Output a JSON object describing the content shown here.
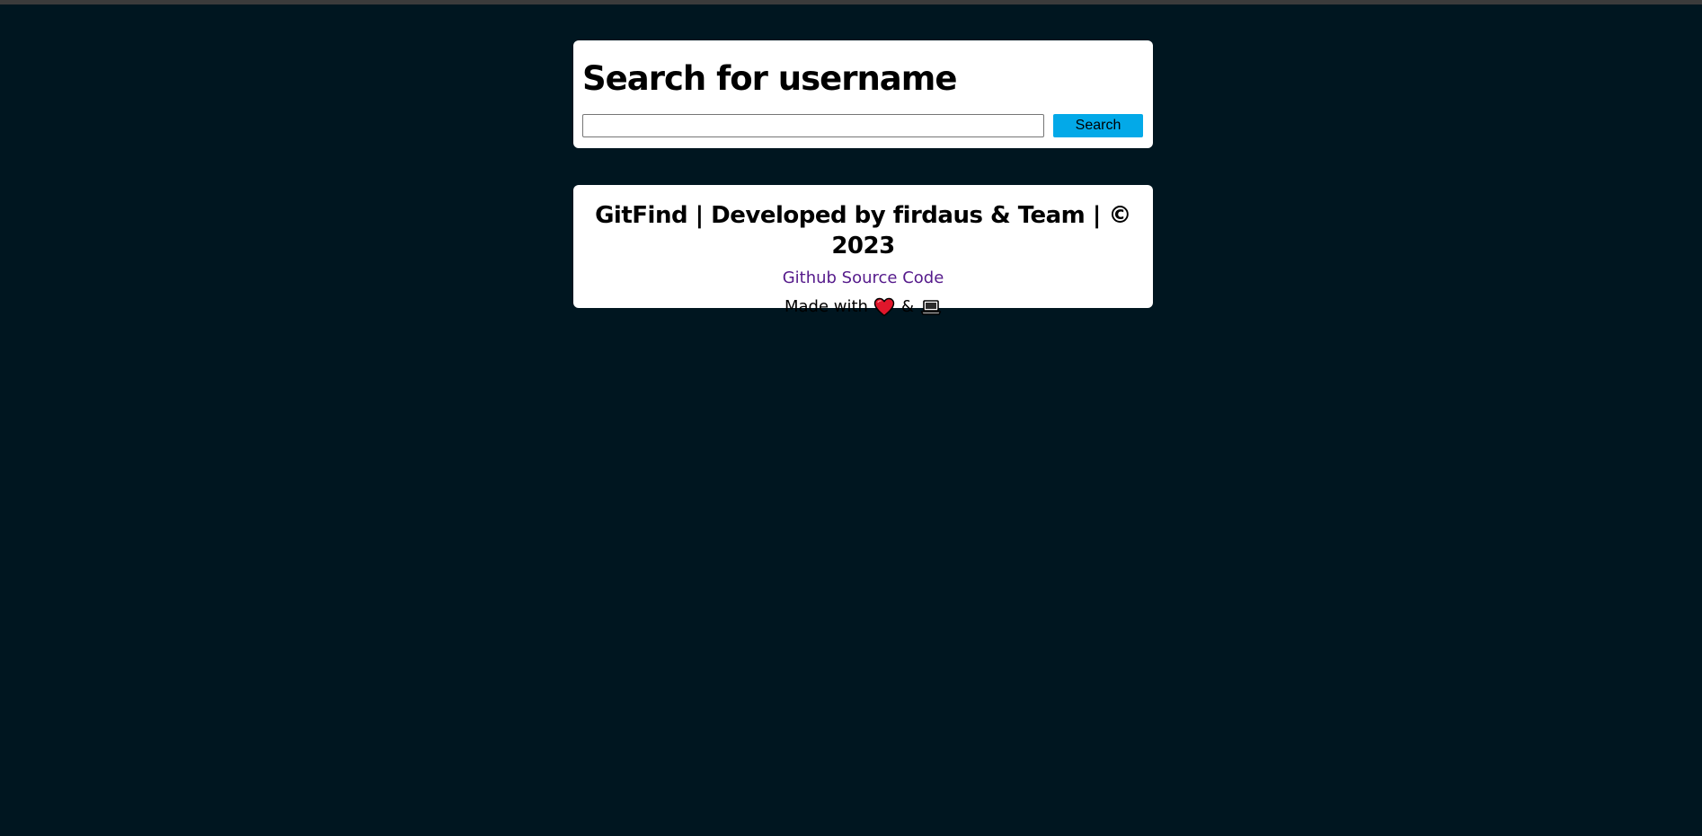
{
  "search": {
    "title": "Search for username",
    "input_value": "",
    "input_placeholder": "",
    "button_label": "Search"
  },
  "footer": {
    "title": "GitFind | Developed by firdaus & Team | © 2023",
    "link_text": "Github Source Code",
    "made_with_prefix": "Made with",
    "made_with_joiner": "&",
    "icons": [
      "heart-icon",
      "laptop-icon"
    ]
  },
  "colors": {
    "background": "#001620",
    "card": "#ffffff",
    "button": "#03a9e8",
    "link": "#551a8b",
    "heart": "#e0162b"
  }
}
